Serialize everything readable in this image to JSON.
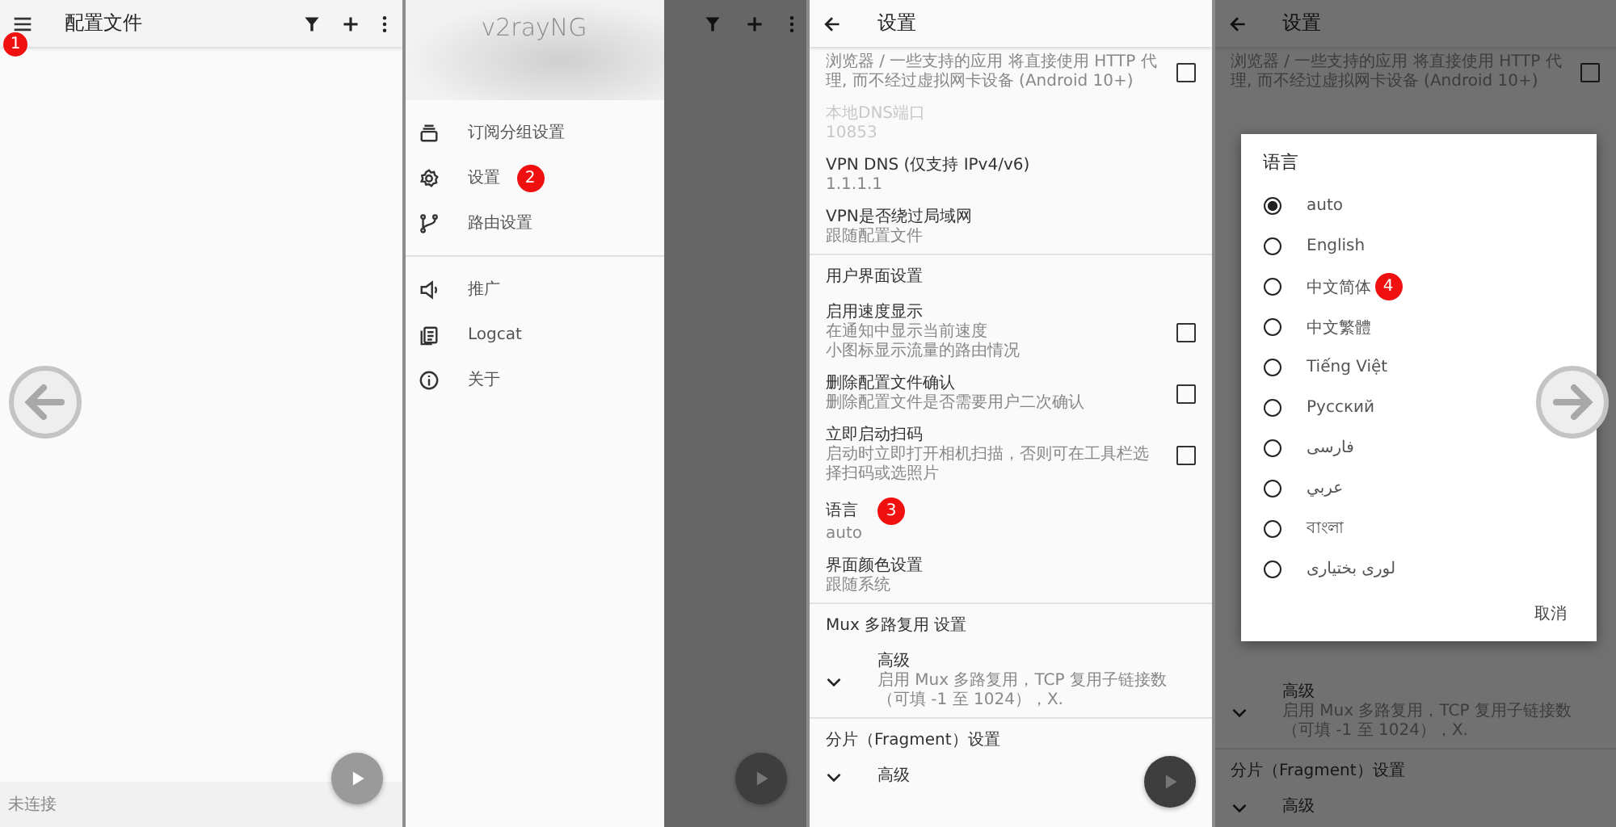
{
  "profiles_screen": {
    "title": "配置文件",
    "step_badge": "1",
    "status": "未连接"
  },
  "drawer_screen": {
    "app_name": "v2rayNG",
    "groups": [
      [
        {
          "label": "订阅分组设置"
        },
        {
          "label": "设置",
          "badge": "2"
        },
        {
          "label": "路由设置"
        }
      ],
      [
        {
          "label": "推广"
        },
        {
          "label": "Logcat"
        },
        {
          "label": "关于"
        }
      ]
    ]
  },
  "settings_screen": {
    "title": "设置",
    "items": [
      {
        "kind": "checkbox",
        "description": "浏览器 / 一些支持的应用 将直接使用 HTTP 代理, 而不经过虚拟网卡设备 (Android 10+)",
        "checked": false,
        "disabled": false
      },
      {
        "kind": "value",
        "title": "本地DNS端口",
        "value": "10853",
        "disabled": true
      },
      {
        "kind": "value",
        "title": "VPN DNS (仅支持 IPv4/v6)",
        "value": "1.1.1.1",
        "disabled": false
      },
      {
        "kind": "value",
        "title": "VPN是否绕过局域网",
        "value": "跟随配置文件",
        "disabled": false
      },
      {
        "kind": "header",
        "title": "用户界面设置"
      },
      {
        "kind": "checkbox",
        "title": "启用速度显示",
        "description_lines": [
          "在通知中显示当前速度",
          "小图标显示流量的路由情况"
        ],
        "checked": false,
        "disabled": false
      },
      {
        "kind": "checkbox",
        "title": "删除配置文件确认",
        "description": "删除配置文件是否需要用户二次确认",
        "checked": false,
        "disabled": false
      },
      {
        "kind": "checkbox",
        "title": "立即启动扫码",
        "description": "启动时立即打开相机扫描，否则可在工具栏选择扫码或选照片",
        "checked": false,
        "disabled": false
      },
      {
        "kind": "value",
        "title": "语言",
        "value": "auto",
        "badge": "3",
        "disabled": false
      },
      {
        "kind": "value",
        "title": "界面颜色设置",
        "value": "跟随系统",
        "disabled": false
      },
      {
        "kind": "header",
        "title": "Mux 多路复用 设置"
      },
      {
        "kind": "expand",
        "title": "高级",
        "description": "启用 Mux 多路复用，TCP 复用子链接数（可填 -1 至 1024），X.",
        "disabled": false
      },
      {
        "kind": "header",
        "title": "分片（Fragment）设置"
      },
      {
        "kind": "expand",
        "title": "高级",
        "disabled": false
      }
    ]
  },
  "language_screen": {
    "title": "设置",
    "behind_top": [
      {
        "kind": "checkbox",
        "description": "浏览器 / 一些支持的应用 将直接使用 HTTP 代理, 而不经过虚拟网卡设备 (Android 10+)",
        "checked": false,
        "disabled": false
      }
    ],
    "behind_bottom": [
      {
        "kind": "expand",
        "title": "高级",
        "description": "启用 Mux 多路复用，TCP 复用子链接数（可填 -1 至 1024），X.",
        "disabled": false
      },
      {
        "kind": "header",
        "title": "分片（Fragment）设置"
      },
      {
        "kind": "expand",
        "title": "高级",
        "disabled": false
      }
    ],
    "dialog": {
      "title": "语言",
      "options": [
        {
          "label": "auto",
          "selected": true
        },
        {
          "label": "English",
          "selected": false
        },
        {
          "label": "中文简体",
          "selected": false,
          "badge": "4"
        },
        {
          "label": "中文繁體",
          "selected": false
        },
        {
          "label": "Tiếng Việt",
          "selected": false
        },
        {
          "label": "Русский",
          "selected": false
        },
        {
          "label": "فارسی",
          "selected": false
        },
        {
          "label": "عربي",
          "selected": false
        },
        {
          "label": "বাংলা",
          "selected": false
        },
        {
          "label": "لوری بختیاری",
          "selected": false
        }
      ],
      "cancel": "取消"
    }
  }
}
